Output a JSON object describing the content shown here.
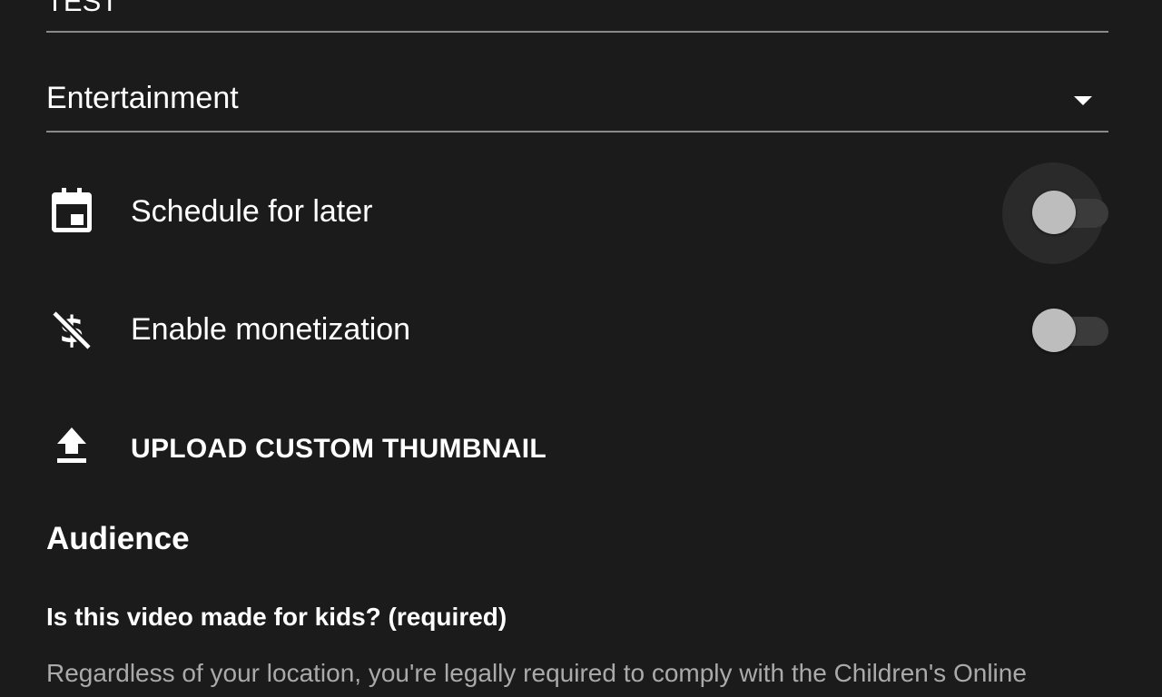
{
  "details": {
    "title_value": "TEST",
    "category": {
      "selected": "Entertainment",
      "icon": "arrow-drop-down-icon"
    }
  },
  "settings": {
    "schedule": {
      "label": "Schedule for later",
      "icon": "calendar-icon",
      "enabled": false
    },
    "monetization": {
      "label": "Enable monetization",
      "icon": "money-off-icon",
      "enabled": false
    },
    "thumbnail": {
      "label": "UPLOAD CUSTOM THUMBNAIL",
      "icon": "upload-icon"
    }
  },
  "audience": {
    "heading": "Audience",
    "question": "Is this video made for kids? (required)",
    "description": "Regardless of your location, you're legally required to comply with the Children's Online"
  },
  "colors": {
    "background": "#1b1b1b",
    "text_primary": "#ffffff",
    "text_secondary": "#aaaaaa",
    "underline": "#8a8a8a",
    "toggle_thumb_off": "#bdbdbd",
    "toggle_track_off": "#3b3b3b"
  }
}
